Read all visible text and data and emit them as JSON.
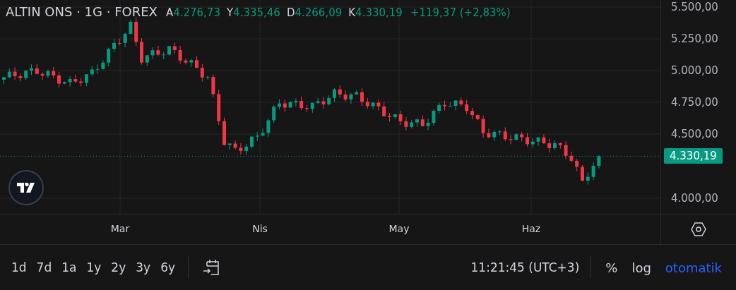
{
  "header": {
    "symbol": "ALTIN ONS · 1G · FOREX",
    "ohlc": [
      {
        "label": "A",
        "value": "4.276,73"
      },
      {
        "label": "Y",
        "value": "4.335,46"
      },
      {
        "label": "D",
        "value": "4.266,09"
      },
      {
        "label": "K",
        "value": "4.330,19"
      }
    ],
    "change": "+119,37 (+2,83%)"
  },
  "price_axis": {
    "ticks": [
      "5.500,00",
      "5.250,00",
      "5.000,00",
      "4.750,00",
      "4.500,00",
      "4.000,00"
    ],
    "last_price": "4.330,19"
  },
  "time_axis": {
    "labels": [
      "Mar",
      "Nis",
      "May",
      "Haz"
    ]
  },
  "toolbar": {
    "ranges": [
      {
        "label": "1d"
      },
      {
        "label": "7d"
      },
      {
        "label": "1a"
      },
      {
        "label": "1y"
      },
      {
        "label": "2y"
      },
      {
        "label": "3y"
      },
      {
        "label": "6y"
      }
    ],
    "clock": "11:21:45 (UTC+3)",
    "percent": "%",
    "log": "log",
    "auto": {
      "label": "otomatik",
      "on": true
    }
  }
}
